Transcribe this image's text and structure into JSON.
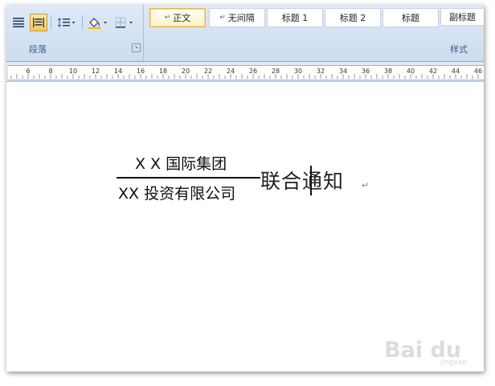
{
  "ribbon": {
    "paragraph_group_label": "段落",
    "styles_group_label": "样式",
    "tools": [
      {
        "icon": "align-justify-icon",
        "selected": false
      },
      {
        "icon": "distributed-align-icon",
        "selected": true
      },
      {
        "icon": "line-spacing-icon",
        "selected": false
      },
      {
        "icon": "shading-fill-icon",
        "selected": false
      },
      {
        "icon": "borders-icon",
        "selected": false
      }
    ],
    "styles": [
      {
        "label": "正文",
        "mark": "↵",
        "selected": true
      },
      {
        "label": "无间隔",
        "mark": "↵",
        "selected": false
      },
      {
        "label": "标题 1",
        "mark": "",
        "selected": false
      },
      {
        "label": "标题 2",
        "mark": "",
        "selected": false
      },
      {
        "label": "标题",
        "mark": "",
        "selected": false
      },
      {
        "label": "副标题",
        "mark": "",
        "selected": false
      }
    ]
  },
  "ruler": {
    "labels": [
      "6",
      "8",
      "10",
      "12",
      "14",
      "16",
      "18",
      "20",
      "22",
      "24",
      "26",
      "28",
      "30",
      "32",
      "34",
      "36",
      "38",
      "40",
      "42",
      "44",
      "46"
    ]
  },
  "document": {
    "line_top": "X X 国际集团",
    "line_bottom": "XX 投资有限公司",
    "text_before_cursor": "联合",
    "text_after_cursor": "通知",
    "paragraph_mark": "↵"
  },
  "watermark": {
    "brand": "Bai du",
    "sub": "jingyan"
  }
}
